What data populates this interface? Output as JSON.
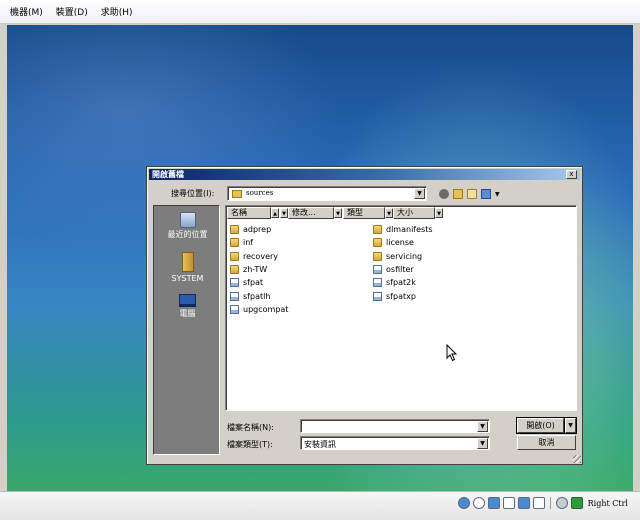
{
  "host": {
    "menu": [
      "機器(M)",
      "裝置(D)",
      "求助(H)"
    ],
    "status": {
      "host_key": "Right Ctrl"
    }
  },
  "dialog": {
    "title": "開啟舊檔",
    "close_label": "x",
    "look_in_label": "搜尋位置(I):",
    "look_in_value": "sources",
    "places": [
      {
        "label": "最近的位置",
        "icon": "recent-places-icon"
      },
      {
        "label": "SYSTEM",
        "icon": "user-folder-icon"
      },
      {
        "label": "電腦",
        "icon": "computer-icon"
      }
    ],
    "columns": [
      "名稱",
      "修改...",
      "類型",
      "大小"
    ],
    "files_col1": [
      {
        "name": "adprep",
        "kind": "folder"
      },
      {
        "name": "inf",
        "kind": "folder"
      },
      {
        "name": "recovery",
        "kind": "folder"
      },
      {
        "name": "zh-TW",
        "kind": "folder"
      },
      {
        "name": "sfpat",
        "kind": "file"
      },
      {
        "name": "sfpatlh",
        "kind": "file"
      },
      {
        "name": "upgcompat",
        "kind": "file"
      }
    ],
    "files_col2": [
      {
        "name": "dlmanifests",
        "kind": "folder"
      },
      {
        "name": "license",
        "kind": "folder"
      },
      {
        "name": "servicing",
        "kind": "folder"
      },
      {
        "name": "osfilter",
        "kind": "file"
      },
      {
        "name": "sfpat2k",
        "kind": "file"
      },
      {
        "name": "sfpatxp",
        "kind": "file"
      }
    ],
    "filename_label": "檔案名稱(N):",
    "filename_value": "",
    "filetype_label": "檔案類型(T):",
    "filetype_value": "安裝資訊",
    "open_label": "開啟(O)",
    "cancel_label": "取消"
  }
}
